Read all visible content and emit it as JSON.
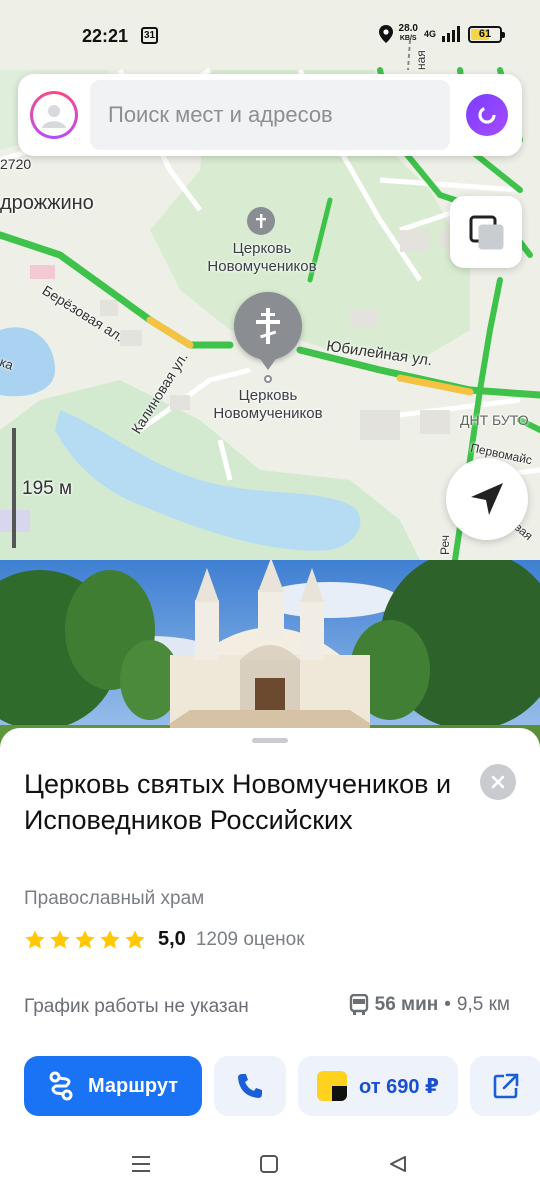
{
  "status_bar": {
    "time": "22:21",
    "calendar_day": "31",
    "speed_value": "28.0",
    "speed_unit": "KB/S",
    "network": "4G",
    "battery": "61"
  },
  "search": {
    "placeholder": "Поиск мест и адресов"
  },
  "map": {
    "labels": {
      "place_top_line1": "Церковь",
      "place_top_line2": "Новомучеников",
      "place_pin_line1": "Церковь",
      "place_pin_line2": "Новомучеников",
      "village": "дрожжино",
      "number": "2720",
      "lake": "ка",
      "dnt": "ДНТ БУТО"
    },
    "streets": {
      "berezovaya": "Берёзовая ал.",
      "kalinovaya": "Калиновая ул.",
      "yubileynaya": "Юбилейная ул.",
      "pervomayskaya": "Первомайс",
      "sadovaya": "Садовая",
      "rech": "Реч",
      "vertical": "ная"
    },
    "scale": "195 м"
  },
  "place": {
    "title": "Церковь святых Новомучеников и Исповедников Российских",
    "category": "Православный храм",
    "rating_value": "5,0",
    "rating_stars": 5,
    "rating_count": "1209 оценок",
    "hours": "График работы не указан",
    "transit_duration": "56 мин",
    "transit_separator": "•",
    "transit_distance": "9,5 км"
  },
  "actions": {
    "route_label": "Маршрут",
    "taxi_label": "от 690 ₽"
  },
  "colors": {
    "accent": "#1a73f5",
    "star": "#ffc800",
    "road_green": "#3ec24a",
    "road_yellow": "#f5c242"
  }
}
